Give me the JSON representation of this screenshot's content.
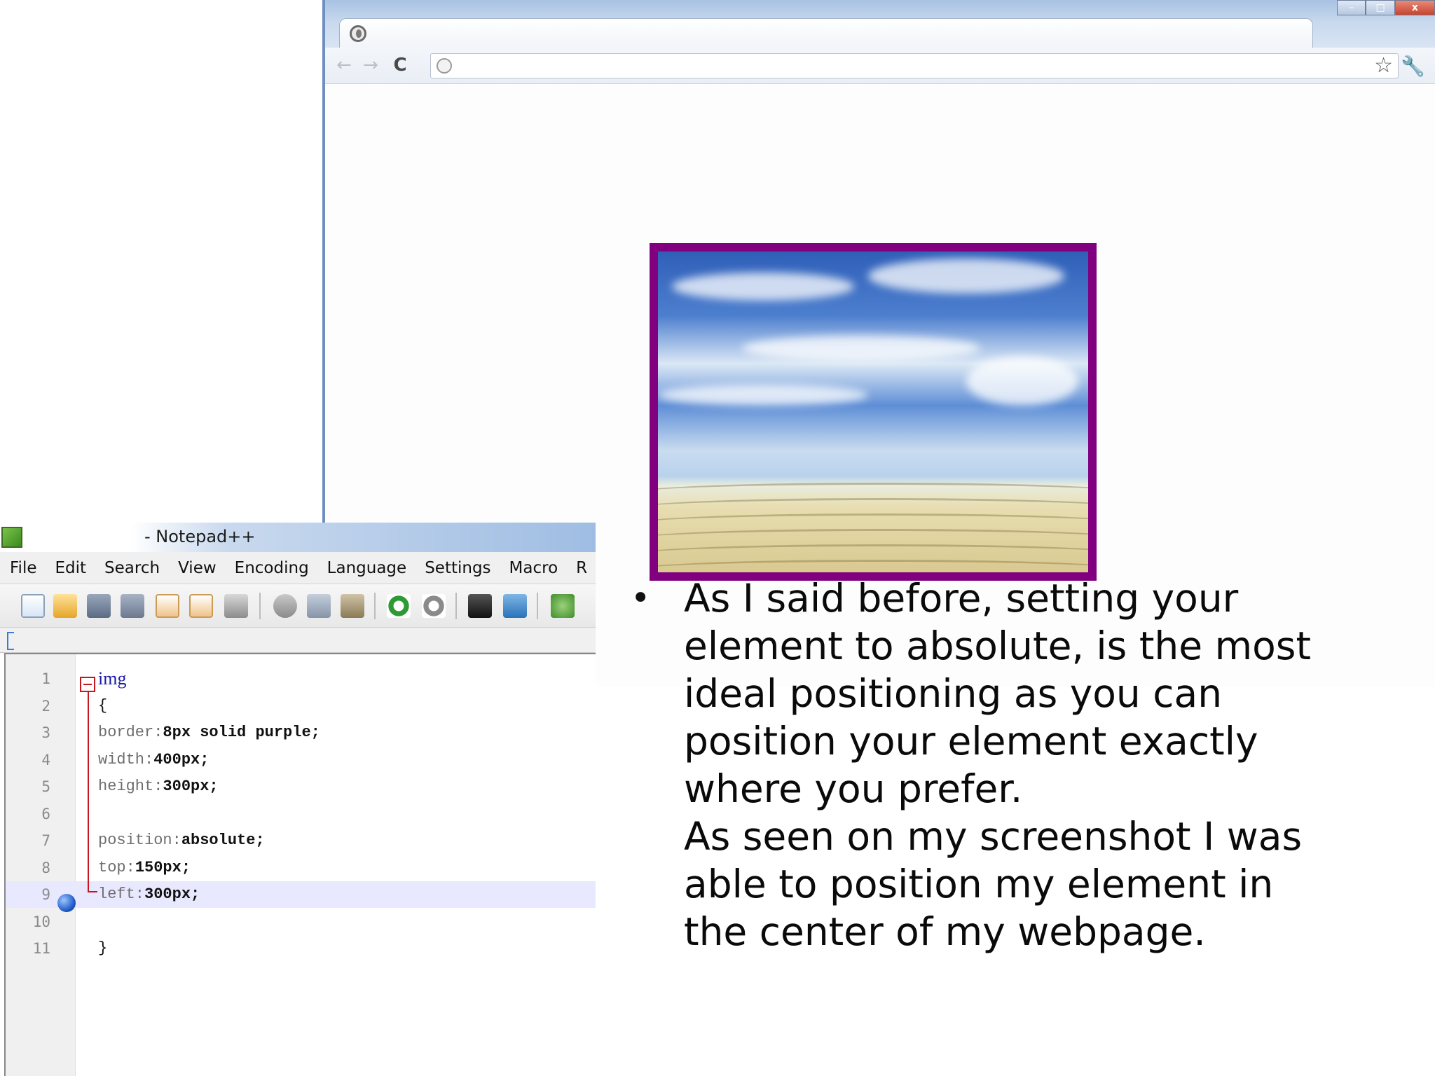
{
  "browser": {
    "tab_title": "",
    "address_url": "",
    "nav": {
      "back_label": "←",
      "forward_label": "→",
      "reload_label": "C"
    },
    "window_controls": {
      "minimize_label": "–",
      "maximize_label": "□",
      "close_label": "x"
    },
    "icons": [
      "globe-icon",
      "page-icon",
      "bookmark-star-icon",
      "wrench-icon"
    ],
    "image_border_color": "#800080"
  },
  "notepad": {
    "title": "- Notepad++",
    "menu": [
      "File",
      "Edit",
      "Search",
      "View",
      "Encoding",
      "Language",
      "Settings",
      "Macro",
      "R"
    ],
    "toolbar_icons": [
      "new-file-icon",
      "open-file-icon",
      "save-icon",
      "save-all-icon",
      "close-icon",
      "close-all-icon",
      "print-icon",
      "cut-icon",
      "copy-icon",
      "paste-icon",
      "undo-icon",
      "redo-icon",
      "find-icon",
      "replace-icon",
      "zoom-in-icon"
    ],
    "code_lines": [
      {
        "number": "1",
        "property": "",
        "value": "img",
        "kind": "selector"
      },
      {
        "number": "2",
        "property": "",
        "value": "{",
        "kind": "brace"
      },
      {
        "number": "3",
        "property": "border:",
        "value": "8px solid purple;",
        "kind": "decl"
      },
      {
        "number": "4",
        "property": "width:",
        "value": "400px;",
        "kind": "decl"
      },
      {
        "number": "5",
        "property": "height:",
        "value": "300px;",
        "kind": "decl"
      },
      {
        "number": "6",
        "property": "",
        "value": "",
        "kind": "blank"
      },
      {
        "number": "7",
        "property": "position:",
        "value": "absolute;",
        "kind": "decl"
      },
      {
        "number": "8",
        "property": "top:",
        "value": "150px;",
        "kind": "decl"
      },
      {
        "number": "9",
        "property": "left:",
        "value": "300px;",
        "kind": "decl"
      },
      {
        "number": "10",
        "property": "",
        "value": "",
        "kind": "blank"
      },
      {
        "number": "11",
        "property": "",
        "value": "}",
        "kind": "brace"
      }
    ],
    "current_line": "9"
  },
  "slide": {
    "bullet": "•",
    "lines": [
      "As I said before, setting your",
      "element to absolute, is the most",
      "ideal positioning as you can",
      "position your element exactly",
      "where you prefer.",
      "As seen on my screenshot I was",
      "able to position my element in",
      "the center of my webpage."
    ]
  }
}
